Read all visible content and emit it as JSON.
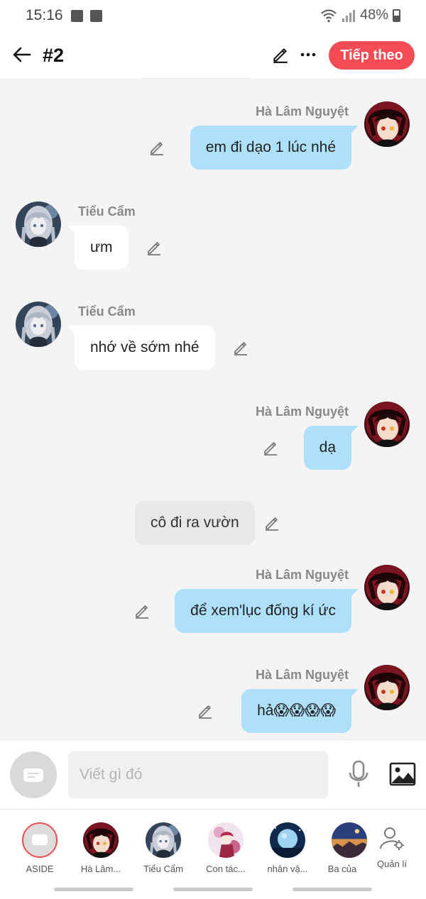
{
  "status_bar": {
    "time": "15:16",
    "battery": "48%",
    "icons": [
      "image-icon",
      "check-square-icon",
      "wifi-icon",
      "signal-icon",
      "battery-icon"
    ]
  },
  "header": {
    "title": "#2",
    "next_label": "Tiếp theo"
  },
  "messages": [
    {
      "side": "right",
      "sender": "Hà Lâm Nguyệt",
      "text": "em đi dạo 1 lúc nhé"
    },
    {
      "side": "left",
      "sender": "Tiểu Cẩm",
      "text": "ưm"
    },
    {
      "side": "left",
      "sender": "Tiểu Cẩm",
      "text": "nhớ về sớm nhé"
    },
    {
      "side": "right",
      "sender": "Hà Lâm Nguyệt",
      "text": "dạ"
    },
    {
      "side": "narration",
      "sender": "",
      "text": "cô đi ra vườn"
    },
    {
      "side": "right",
      "sender": "Hà Lâm Nguyệt",
      "text": "để xem'lục đống kí ức"
    },
    {
      "side": "right",
      "sender": "Hà Lâm Nguyệt",
      "text": "hả😱😱😱😱"
    }
  ],
  "input": {
    "placeholder": "Viết gì đó"
  },
  "characters": [
    {
      "label": "ASIDE"
    },
    {
      "label": "Hà Lâm..."
    },
    {
      "label": "Tiểu Cẩm"
    },
    {
      "label": "Con tác..."
    },
    {
      "label": "nhân vậ..."
    },
    {
      "label": "Ba của"
    }
  ],
  "manage_label": "Quản lí",
  "colors": {
    "accent": "#f44b54",
    "bubble_right": "#aee0fb",
    "bubble_left": "#ffffff",
    "background": "#f4f4f4"
  }
}
